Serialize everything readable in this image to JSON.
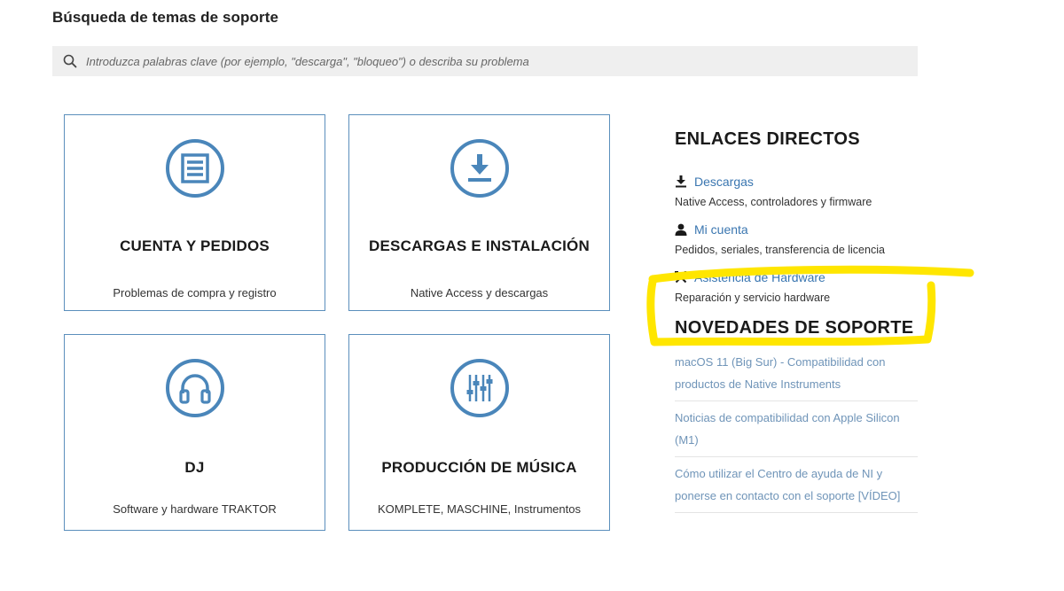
{
  "search": {
    "title": "Búsqueda de temas de soporte",
    "placeholder": "Introduzca palabras clave (por ejemplo, \"descarga\", \"bloqueo\") o describa su problema",
    "icon": "search-icon"
  },
  "cards": [
    {
      "title": "CUENTA Y PEDIDOS",
      "desc": "Problemas de compra y registro",
      "icon": "list-icon"
    },
    {
      "title": "DESCARGAS E INSTALACIÓN",
      "desc": "Native Access y descargas",
      "icon": "download-icon"
    },
    {
      "title": "DJ",
      "desc": "Software y hardware TRAKTOR",
      "icon": "headphones-icon"
    },
    {
      "title": "PRODUCCIÓN DE MÚSICA",
      "desc": "KOMPLETE, MASCHINE, Instrumentos",
      "icon": "mixer-icon"
    }
  ],
  "quick_links": {
    "heading": "ENLACES DIRECTOS",
    "items": [
      {
        "label": "Descargas",
        "desc": "Native Access, controladores y firmware",
        "icon": "download-icon"
      },
      {
        "label": "Mi cuenta",
        "desc": "Pedidos, seriales, transferencia de licencia",
        "icon": "user-icon"
      },
      {
        "label": "Asistencia de Hardware",
        "desc": "Reparación y servicio hardware",
        "icon": "tools-icon"
      }
    ]
  },
  "news": {
    "heading": "NOVEDADES DE SOPORTE",
    "items": [
      {
        "label": "macOS 11 (Big Sur) - Compatibilidad con productos de Native Instruments"
      },
      {
        "label": "Noticias de compatibilidad con Apple Silicon (M1)"
      },
      {
        "label": "Cómo utilizar el Centro de ayuda de NI y ponerse en contacto con el soporte [VÍDEO]"
      }
    ]
  },
  "colors": {
    "accent": "#3a76b0",
    "card_border": "#5b8fbc",
    "icon_blue": "#4a86ba",
    "highlight": "#ffe600"
  }
}
